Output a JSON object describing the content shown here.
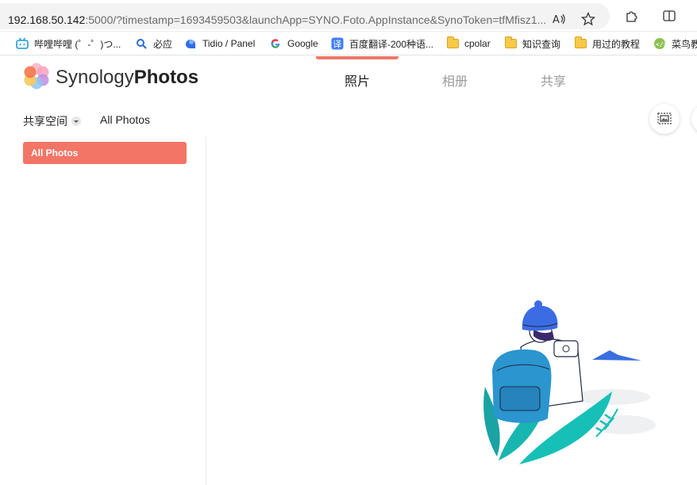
{
  "browser": {
    "url_host": "192.168.50.142",
    "url_rest": ":5000/?timestamp=1693459503&launchApp=SYNO.Foto.AppInstance&SynoToken=tfMfisz1...",
    "icons": [
      "read-aloud-icon",
      "favorite-star-icon",
      "extensions-icon",
      "split-screen-icon"
    ]
  },
  "bookmarks": [
    {
      "label": "哔哩哔哩 (゜-゜)つ...",
      "icon": "bilibili-icon"
    },
    {
      "label": "必应",
      "icon": "bing-search-icon"
    },
    {
      "label": "Tidio / Panel",
      "icon": "tidio-icon"
    },
    {
      "label": "Google",
      "icon": "google-icon"
    },
    {
      "label": "百度翻译-200种语...",
      "icon": "baidu-translate-icon"
    },
    {
      "label": "cpolar",
      "icon": "folder-icon"
    },
    {
      "label": "知识查询",
      "icon": "folder-icon"
    },
    {
      "label": "用过的教程",
      "icon": "folder-icon"
    },
    {
      "label": "菜鸟教",
      "icon": "runoob-icon"
    }
  ],
  "app": {
    "brand_light": "Synology",
    "brand_bold": "Photos",
    "tabs": [
      {
        "label": "照片",
        "active": true
      },
      {
        "label": "相册",
        "active": false
      },
      {
        "label": "共享",
        "active": false
      }
    ],
    "accent": "#ef7868"
  },
  "toolbar": {
    "space_label": "共享空间",
    "breadcrumb": "All Photos",
    "actions": [
      "slideshow-icon"
    ]
  },
  "sidebar": {
    "items": [
      {
        "label": "All Photos",
        "active": true
      }
    ]
  }
}
